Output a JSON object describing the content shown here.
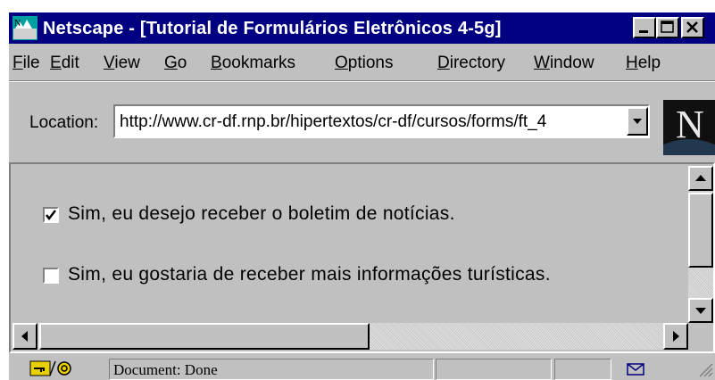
{
  "window": {
    "title": "Netscape - [Tutorial de Formulários Eletrônicos 4-5g]"
  },
  "menu": [
    {
      "pre": "",
      "u": "F",
      "post": "ile"
    },
    {
      "pre": "",
      "u": "E",
      "post": "dit"
    },
    {
      "pre": "",
      "u": "V",
      "post": "iew"
    },
    {
      "pre": "",
      "u": "G",
      "post": "o"
    },
    {
      "pre": "",
      "u": "B",
      "post": "ookmarks"
    },
    {
      "pre": "",
      "u": "O",
      "post": "ptions"
    },
    {
      "pre": "",
      "u": "D",
      "post": "irectory"
    },
    {
      "pre": "",
      "u": "W",
      "post": "indow"
    },
    {
      "pre": "",
      "u": "H",
      "post": "elp"
    }
  ],
  "location": {
    "label": "Location:",
    "url": "http://www.cr-df.rnp.br/hipertextos/cr-df/cursos/forms/ft_4"
  },
  "logo": {
    "letter": "N"
  },
  "form": {
    "options": [
      {
        "label": "Sim, eu desejo receber o boletim de notícias.",
        "checked": true
      },
      {
        "label": "Sim, eu gostaria de receber mais informações turísticas.",
        "checked": false
      }
    ]
  },
  "status": {
    "text": "Document: Done"
  },
  "icons": {
    "app": "netscape-app-icon",
    "security": "security-key-icon",
    "mail": "mail-envelope-icon"
  },
  "colors": {
    "titlebar": "#000080",
    "chrome": "#c0c0c0"
  }
}
